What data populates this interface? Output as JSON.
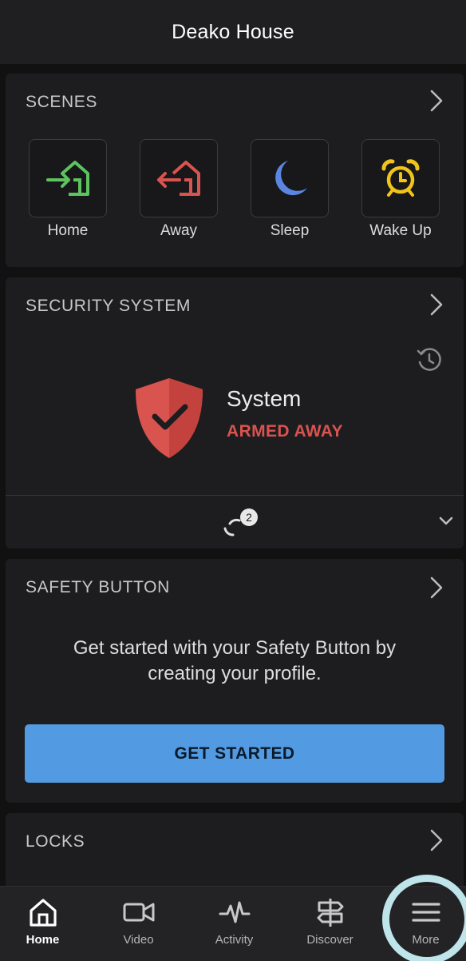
{
  "header": {
    "title": "Deako House"
  },
  "scenes": {
    "title": "SCENES",
    "items": [
      {
        "label": "Home",
        "icon": "home-enter-icon",
        "color": "#5cc35f"
      },
      {
        "label": "Away",
        "icon": "home-exit-icon",
        "color": "#d9534f"
      },
      {
        "label": "Sleep",
        "icon": "moon-icon",
        "color": "#5b86e0"
      },
      {
        "label": "Wake Up",
        "icon": "alarm-clock-icon",
        "color": "#f0c419"
      }
    ]
  },
  "security": {
    "title": "SECURITY SYSTEM",
    "system_label": "System",
    "status": "ARMED AWAY",
    "status_color": "#d9534f",
    "sync_badge": "2"
  },
  "safety": {
    "title": "SAFETY BUTTON",
    "description": "Get started with your Safety Button by creating your profile.",
    "button_label": "GET STARTED",
    "button_color": "#529be3"
  },
  "locks": {
    "title": "LOCKS"
  },
  "tabbar": {
    "items": [
      {
        "label": "Home",
        "icon": "house-icon",
        "active": true
      },
      {
        "label": "Video",
        "icon": "video-camera-icon",
        "active": false
      },
      {
        "label": "Activity",
        "icon": "pulse-icon",
        "active": false
      },
      {
        "label": "Discover",
        "icon": "signpost-icon",
        "active": false
      },
      {
        "label": "More",
        "icon": "hamburger-menu-icon",
        "active": false
      }
    ]
  }
}
